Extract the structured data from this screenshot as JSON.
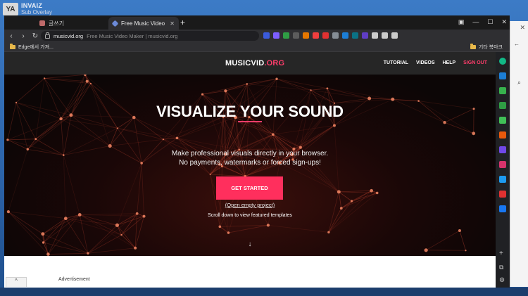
{
  "overlay_app": {
    "logo": "YA",
    "name": "INVAIZ",
    "subtitle": "Sub Overlay"
  },
  "browser": {
    "tabs": [
      {
        "label": "글쓰기",
        "active": false
      },
      {
        "label": "Free Music Video Maker | musi",
        "active": true
      }
    ],
    "new_tab": "+",
    "window_controls": [
      "▣",
      "—",
      "☐",
      "✕"
    ],
    "address": {
      "domain": "musicvid.org",
      "title": "Free Music Video Maker | musicvid.org"
    },
    "bookmarks": {
      "left": "Edge에서 가져...",
      "right": "기타 북마크"
    },
    "extension_colors": [
      "#3b5bdb",
      "#7d5fff",
      "#2f9e44",
      "#5c5c5c",
      "#e67700",
      "#f03e3e",
      "#e03131",
      "#868e96",
      "#1c7ed6",
      "#0b7285",
      "#5f3dc4",
      "#ccc",
      "#ccc",
      "#ccc"
    ]
  },
  "site": {
    "logo_main": "MUSICVID",
    "logo_accent": ".ORG",
    "nav": [
      "TUTORIAL",
      "VIDEOS",
      "HELP",
      "SIGN OUT"
    ],
    "hero": {
      "title": "VISUALIZE YOUR SOUND",
      "subtitle_line1": "Make professional visuals directly in your browser.",
      "subtitle_line2": "No payments, watermarks or forced sign-ups!",
      "cta": "GET STARTED",
      "secondary_link": "(Open empty project)",
      "scroll_hint": "Scroll down to view featured templates",
      "down_arrow": "↓"
    },
    "advertisement_label": "Advertisement",
    "scroll_up": "^"
  },
  "sidebar_icons": [
    {
      "name": "circle-app-icon",
      "color": "#12b886"
    },
    {
      "name": "outlook-icon",
      "color": "#1c7ed6"
    },
    {
      "name": "games-icon",
      "color": "#37b24d"
    },
    {
      "name": "chart-icon",
      "color": "#2f9e44"
    },
    {
      "name": "note-icon",
      "color": "#40c057"
    },
    {
      "name": "office-icon",
      "color": "#e8590c"
    },
    {
      "name": "tools-icon",
      "color": "#7048e8"
    },
    {
      "name": "instagram-icon",
      "color": "#d6336c"
    },
    {
      "name": "twitter-icon",
      "color": "#1d9bf0"
    },
    {
      "name": "youtube-icon",
      "color": "#e03131"
    },
    {
      "name": "facebook-icon",
      "color": "#1877f2"
    }
  ],
  "sidebar_tools": {
    "add": "+",
    "extensions": "⧉",
    "settings": "⚙"
  },
  "colors": {
    "accent": "#ff2f5d",
    "nav_bg": "#262626"
  }
}
